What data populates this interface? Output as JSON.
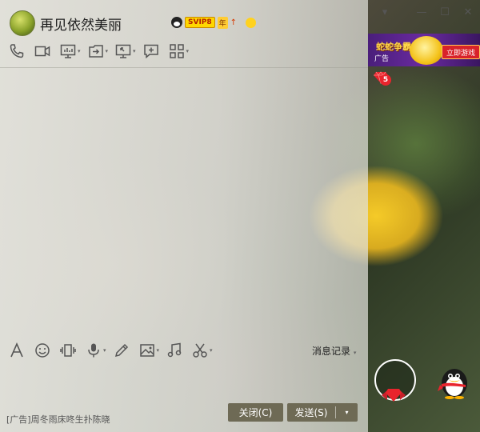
{
  "window": {
    "contact_name": "再见依然美丽",
    "badges": {
      "svip": "SVIP8",
      "nian": "年",
      "arrow": "↑"
    },
    "controls": {
      "dropdown": "▾",
      "minimize": "—",
      "maximize": "☐",
      "close": "✕"
    }
  },
  "toolbar_top": {
    "icons": [
      "phone-icon",
      "video-icon",
      "screen-share-icon",
      "file-transfer-icon",
      "remote-desktop-icon",
      "message-add-icon",
      "apps-grid-icon"
    ]
  },
  "toolbar_bottom": {
    "icons": [
      "font-icon",
      "emoji-icon",
      "shake-icon",
      "mic-icon",
      "pen-icon",
      "image-icon",
      "music-icon",
      "scissors-icon"
    ],
    "history_label": "消息记录",
    "history_drop": "▾"
  },
  "footer": {
    "ad_text": "[广告]周冬雨床咚生扑陈晓",
    "close_button": "关闭(C)",
    "send_button": "发送(S)",
    "send_drop": "▾"
  },
  "right_panel": {
    "banner": {
      "game_title": "蛇蛇争霸",
      "tag": "广告",
      "play_button": "立即游戏"
    },
    "gem_count": "5"
  },
  "colors": {
    "button_bg": "#6e6a55",
    "accent_red": "#d8222a",
    "flower_yellow": "#ffd21f"
  }
}
